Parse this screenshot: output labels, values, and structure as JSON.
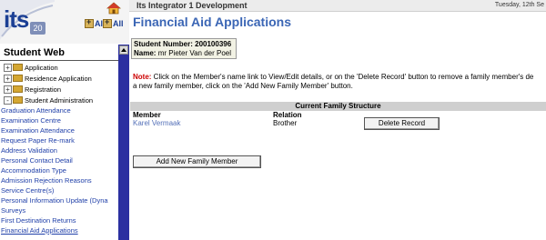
{
  "topbar": {
    "title": "Its Integrator 1 Development",
    "date": "Tuesday, 12th Se"
  },
  "logo": {
    "text": "its",
    "version": "20"
  },
  "nav_buttons": [
    {
      "label": "All",
      "icon": "expand-all-icon"
    },
    {
      "label": "All",
      "icon": "collapse-all-icon"
    }
  ],
  "sidebar": {
    "header": "Student Web",
    "tree": [
      {
        "label": "Application",
        "expander": "+"
      },
      {
        "label": "Residence Application",
        "expander": "+"
      },
      {
        "label": "Registration",
        "expander": "+"
      },
      {
        "label": "Student Administration",
        "expander": "-"
      }
    ],
    "sub_items": [
      "Graduation Attendance",
      "Examination Centre",
      "Examination Attendance",
      "Request Paper Re-mark",
      "Address Validation",
      "Personal Contact Detail",
      "Accommodation Type",
      "Admission Rejection Reasons",
      "Service Centre(s)",
      "Personal Information Update (Dyna",
      "Surveys",
      "First Destination Returns",
      "Financial Aid Applications"
    ]
  },
  "main": {
    "title": "Financial Aid Applications",
    "student_number_label": "Student Number:",
    "student_number": "200100396",
    "name_label": "Name:",
    "name": "mr Pieter Van der Poel",
    "note_label": "Note:",
    "note_text": " Click on the Member's name link to View/Edit details, or on the 'Delete Record' button to remove a family member's de",
    "note_text2": "a new family member, click on the 'Add New Family Member' button.",
    "structure_title": "Current Family Structure",
    "columns": [
      "Member",
      "Relation"
    ],
    "rows": [
      {
        "member": "Karel Vermaak",
        "relation": "Brother",
        "delete_label": "Delete Record"
      }
    ],
    "add_label": "Add New Family Member"
  }
}
